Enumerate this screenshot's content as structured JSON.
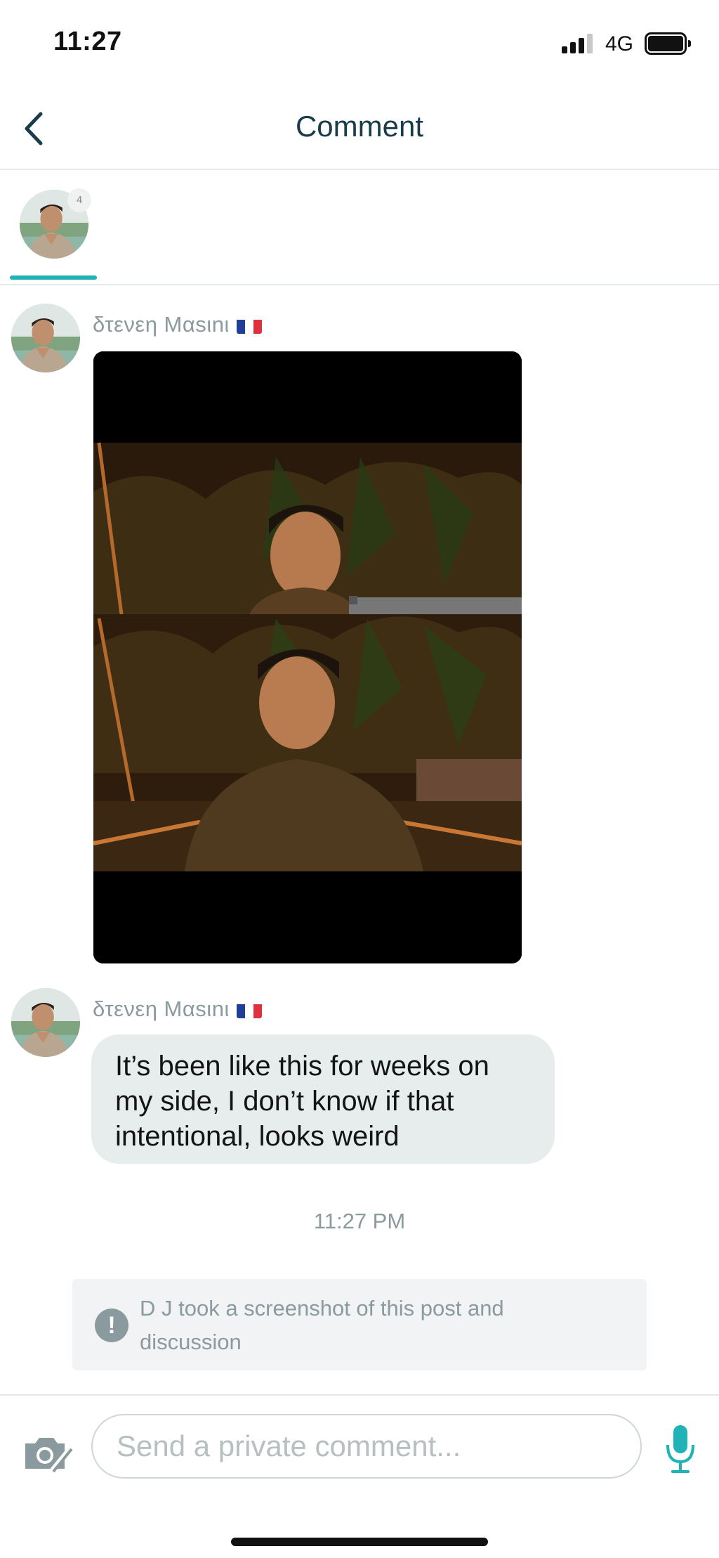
{
  "status_bar": {
    "time": "11:27",
    "network": "4G"
  },
  "header": {
    "title": "Comment",
    "back_icon": "chevron-left-icon"
  },
  "participants": {
    "count_badge": "4"
  },
  "messages": [
    {
      "sender": "δτενεη Mαsιnι",
      "type": "image"
    },
    {
      "sender": "δτενεη Mαsιnι",
      "type": "text",
      "text": "It’s been like this for weeks on my side, I don’t know if that intentional, looks weird"
    }
  ],
  "timestamp": "11:27 PM",
  "notice": {
    "icon": "exclamation-icon",
    "text": "D J took a screenshot of this post and discussion"
  },
  "composer": {
    "placeholder": "Send a private comment...",
    "camera_icon": "camera-icon",
    "mic_icon": "microphone-icon"
  },
  "colors": {
    "accent": "#1fb3b8",
    "bubble": "#e6edec",
    "muted_text": "#8b9a9e",
    "title": "#1a3b4a"
  }
}
